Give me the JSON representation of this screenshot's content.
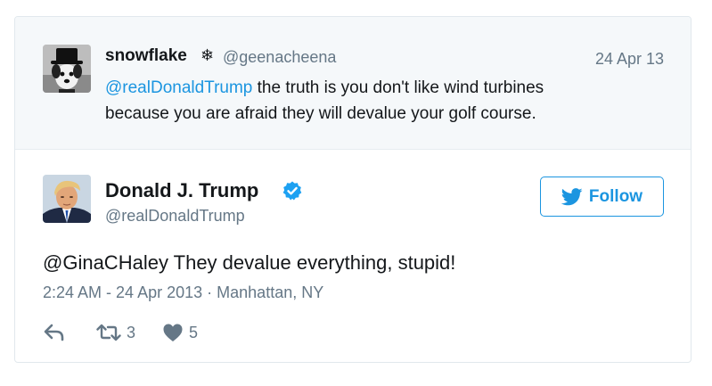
{
  "quoted_tweet": {
    "display_name": "snowflake",
    "snowflake_glyph": "❄",
    "handle": "@geenacheena",
    "date": "24 Apr 13",
    "mention": "@realDonaldTrump",
    "text_line1": " the truth is you don't like wind turbines",
    "text_line2": "because you are afraid they will devalue your golf course.",
    "avatar_icon": "dog-in-top-hat-avatar"
  },
  "tweet": {
    "display_name": "Donald J. Trump",
    "handle": "@realDonaldTrump",
    "verified_icon": "verified-badge-icon",
    "follow_label": "Follow",
    "text": "@GinaCHaley They devalue everything, stupid!",
    "timestamp": "2:24 AM - 24 Apr 2013",
    "separator": "·",
    "location": "Manhattan, NY",
    "retweet_count": "3",
    "like_count": "5"
  },
  "colors": {
    "accent": "#1b95e0",
    "muted_text": "#657786",
    "quoted_background": "#f5f8fa",
    "border": "#e1e8ed"
  }
}
